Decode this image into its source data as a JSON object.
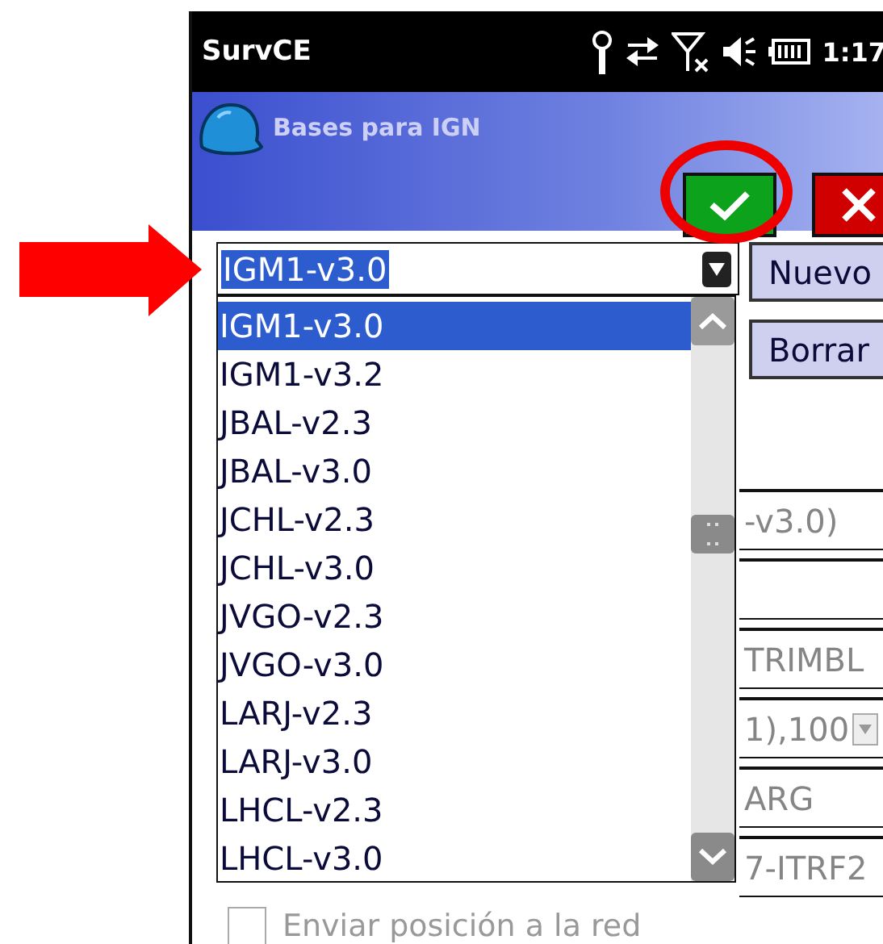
{
  "status_bar": {
    "app": "SurvCE",
    "time": "1:17"
  },
  "header": {
    "title": "Bases para IGN"
  },
  "base_combo": {
    "value": "IGM1-v3.0",
    "expanded": true
  },
  "options": [
    {
      "label": "IGM1-v3.0",
      "selected": true
    },
    {
      "label": "IGM1-v3.2",
      "selected": false
    },
    {
      "label": "JBAL-v2.3",
      "selected": false
    },
    {
      "label": "JBAL-v3.0",
      "selected": false
    },
    {
      "label": "JCHL-v2.3",
      "selected": false
    },
    {
      "label": "JCHL-v3.0",
      "selected": false
    },
    {
      "label": "JVGO-v2.3",
      "selected": false
    },
    {
      "label": "JVGO-v3.0",
      "selected": false
    },
    {
      "label": "LARJ-v2.3",
      "selected": false
    },
    {
      "label": "LARJ-v3.0",
      "selected": false
    },
    {
      "label": "LHCL-v2.3",
      "selected": false
    },
    {
      "label": "LHCL-v3.0",
      "selected": false
    }
  ],
  "buttons": [
    "Nuevo",
    "Borrar"
  ],
  "fields": [
    {
      "kind": "text",
      "value": "-v3.0)",
      "disabled": true
    },
    {
      "kind": "text"
    },
    {
      "kind": "text",
      "value": "TRIMBL",
      "disabled": true
    },
    {
      "kind": "combo",
      "value": "1),100",
      "disabled": true
    },
    {
      "kind": "text",
      "value": "ARG",
      "disabled": true
    },
    {
      "kind": "text",
      "value": "7-ITRF2",
      "disabled": true
    }
  ],
  "checkbox": {
    "label": "Enviar posición a la red",
    "checked": false,
    "disabled": true
  },
  "annotations": [
    {
      "kind": "arrow"
    },
    {
      "kind": "circle"
    }
  ]
}
